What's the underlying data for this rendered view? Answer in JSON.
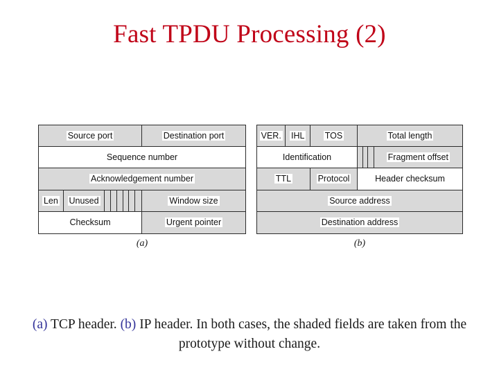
{
  "slide": {
    "title": "Fast TPDU Processing (2)",
    "title_color": "#C00418",
    "background_color": "#ffffff",
    "shaded_cell_color": "#d9d9d9",
    "plain_cell_color": "#ffffff",
    "border_color": "#2b2b2b",
    "caption_ref_color": "#333399"
  },
  "figure": {
    "tcp_header": {
      "sub_caption": "(a)",
      "rows": [
        {
          "cells": [
            {
              "label": "Source port",
              "shaded": true,
              "width_pct": 50
            },
            {
              "label": "Destination  port",
              "shaded": true,
              "width_pct": 50
            }
          ]
        },
        {
          "cells": [
            {
              "label": "Sequence number",
              "shaded": false,
              "width_pct": 100
            }
          ]
        },
        {
          "cells": [
            {
              "label": "Acknowledgement number",
              "shaded": true,
              "width_pct": 100
            }
          ]
        },
        {
          "cells": [
            {
              "label": "Len",
              "shaded": true,
              "width_pct": 12
            },
            {
              "label": "Unused",
              "shaded": true,
              "width_pct": 20
            },
            {
              "label": "",
              "shaded": true,
              "width_pct": 18,
              "flagbits": 6
            },
            {
              "label": "Window size",
              "shaded": true,
              "width_pct": 50
            }
          ]
        },
        {
          "cells": [
            {
              "label": "Checksum",
              "shaded": false,
              "width_pct": 50
            },
            {
              "label": "Urgent pointer",
              "shaded": true,
              "width_pct": 50
            }
          ]
        }
      ]
    },
    "ip_header": {
      "sub_caption": "(b)",
      "rows": [
        {
          "cells": [
            {
              "label": "VER.",
              "shaded": true,
              "width_pct": 14
            },
            {
              "label": "IHL",
              "shaded": true,
              "width_pct": 12
            },
            {
              "label": "TOS",
              "shaded": true,
              "width_pct": 23
            },
            {
              "label": "Total length",
              "shaded": true,
              "width_pct": 51
            }
          ]
        },
        {
          "cells": [
            {
              "label": "Identification",
              "shaded": false,
              "width_pct": 49
            },
            {
              "label": "",
              "shaded": true,
              "width_pct": 8,
              "flagbits": 3
            },
            {
              "label": "Fragment offset",
              "shaded": true,
              "width_pct": 43
            }
          ]
        },
        {
          "cells": [
            {
              "label": "TTL",
              "shaded": true,
              "width_pct": 26
            },
            {
              "label": "Protocol",
              "shaded": true,
              "width_pct": 23
            },
            {
              "label": "Header checksum",
              "shaded": false,
              "width_pct": 51
            }
          ]
        },
        {
          "cells": [
            {
              "label": "Source address",
              "shaded": true,
              "width_pct": 100
            }
          ]
        },
        {
          "cells": [
            {
              "label": "Destination address",
              "shaded": true,
              "width_pct": 100
            }
          ]
        }
      ]
    }
  },
  "caption": {
    "ref_a": "(a)",
    "text_a": " TCP header.  ",
    "ref_b": "(b)",
    "text_b": " IP header. In both cases, the shaded fields are taken from the prototype without change."
  }
}
